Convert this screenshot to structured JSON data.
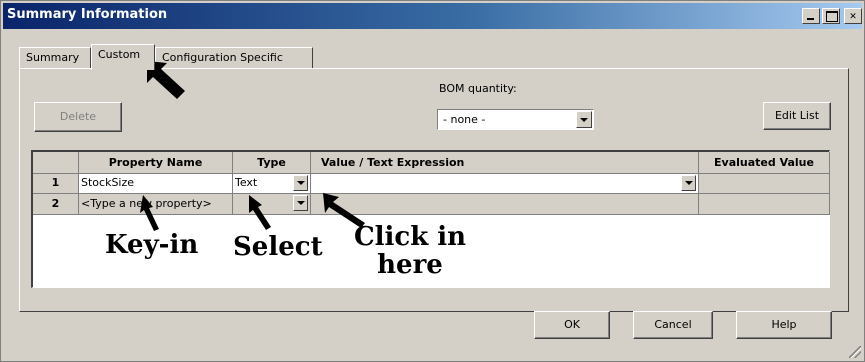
{
  "window": {
    "title": "Summary Information",
    "controls": [
      "minimize-icon",
      "maximize-icon",
      "close-icon"
    ]
  },
  "tabs": [
    {
      "label": "Summary",
      "active": false
    },
    {
      "label": "Custom",
      "active": true
    },
    {
      "label": "Configuration Specific",
      "active": false
    }
  ],
  "toolbar": {
    "delete_label": "Delete",
    "bom_label": "BOM quantity:",
    "bom_value": "- none -",
    "edit_list_label": "Edit List"
  },
  "grid": {
    "headers": [
      "",
      "Property Name",
      "Type",
      "Value / Text Expression",
      "Evaluated Value"
    ],
    "rows": [
      {
        "num": "1",
        "name": "StockSize",
        "type": "Text",
        "value": "",
        "evaluated": ""
      },
      {
        "num": "2",
        "name": "<Type a new property>",
        "type": "",
        "value": "",
        "evaluated": ""
      }
    ]
  },
  "annotations": {
    "keyin": "Key-in",
    "select": "Select",
    "click_line1": "Click in",
    "click_line2": "here"
  },
  "footer": {
    "ok_label": "OK",
    "cancel_label": "Cancel",
    "help_label": "Help"
  },
  "colors": {
    "titlebar_start": "#0a246a",
    "titlebar_end": "#a6caf0",
    "face": "#d4d0c8"
  }
}
